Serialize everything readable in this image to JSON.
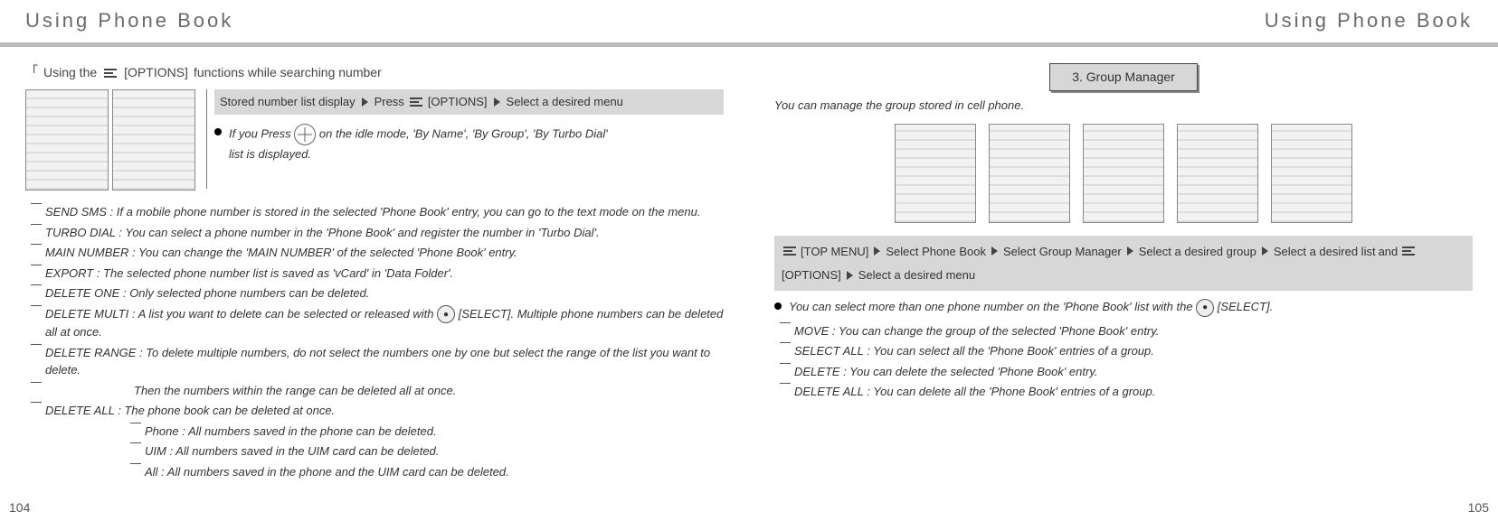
{
  "left": {
    "header": "Using Phone Book",
    "subhead_prefix": "Using the",
    "subhead_options": "[OPTIONS]",
    "subhead_suffix": "functions while searching number",
    "banner": {
      "p1": "Stored number list display",
      "p2": "Press",
      "p3": "[OPTIONS]",
      "p4": "Select a desired menu"
    },
    "tip_a": "If you Press",
    "tip_b": "on the idle mode, 'By Name', 'By Group', 'By Turbo Dial'",
    "tip_c": "list is displayed.",
    "items": {
      "send_sms": "SEND SMS : If a mobile phone number is stored in the selected 'Phone Book' entry, you can go to the text mode on the menu.",
      "turbo": "TURBO DIAL : You can select a phone number in the 'Phone Book' and register the number in 'Turbo Dial'.",
      "main_num": "MAIN NUMBER : You can change the 'MAIN NUMBER' of the selected 'Phone Book' entry.",
      "export": "EXPORT : The selected phone number list is saved as 'vCard' in 'Data Folder'.",
      "del_one": "DELETE ONE : Only selected phone numbers can be deleted.",
      "del_multi_a": "DELETE MULTI : A list you want to delete can be selected or released with",
      "del_multi_b": "[SELECT]. Multiple phone numbers can be deleted all at once.",
      "del_range_a": "DELETE RANGE : To delete multiple numbers, do not select the numbers one by one but select the range of the list you want to delete.",
      "del_range_b": "Then the numbers within the range can be deleted all at once.",
      "del_all": "DELETE ALL : The phone book can be deleted at once.",
      "sub_phone": "Phone : All numbers saved in the phone can be deleted.",
      "sub_uim": "UIM :  All numbers saved in the UIM card can be deleted.",
      "sub_all": "All : All numbers saved in the phone and the UIM card can be deleted."
    },
    "page_num": "104"
  },
  "right": {
    "header": "Using Phone Book",
    "section_title": "3. Group Manager",
    "section_sub": "You can manage the group stored in cell phone.",
    "banner": {
      "p1": "[TOP MENU]",
      "p2": "Select Phone Book",
      "p3": "Select Group Manager",
      "p4": "Select a desired group",
      "p5": "Select a desired list",
      "p6": "and",
      "p7": "[OPTIONS]",
      "p8": "Select a desired menu"
    },
    "bullet_a": "You can select more than one phone number on the 'Phone Book' list with the",
    "bullet_b": "[SELECT].",
    "items": {
      "move": "MOVE : You can change the group of the selected 'Phone Book' entry.",
      "select_all": "SELECT ALL : You can select all the 'Phone Book' entries of a group.",
      "delete": "DELETE : You can delete the selected 'Phone Book' entry.",
      "delete_all": "DELETE ALL : You can delete all the 'Phone Book' entries of a group."
    },
    "page_num": "105"
  }
}
